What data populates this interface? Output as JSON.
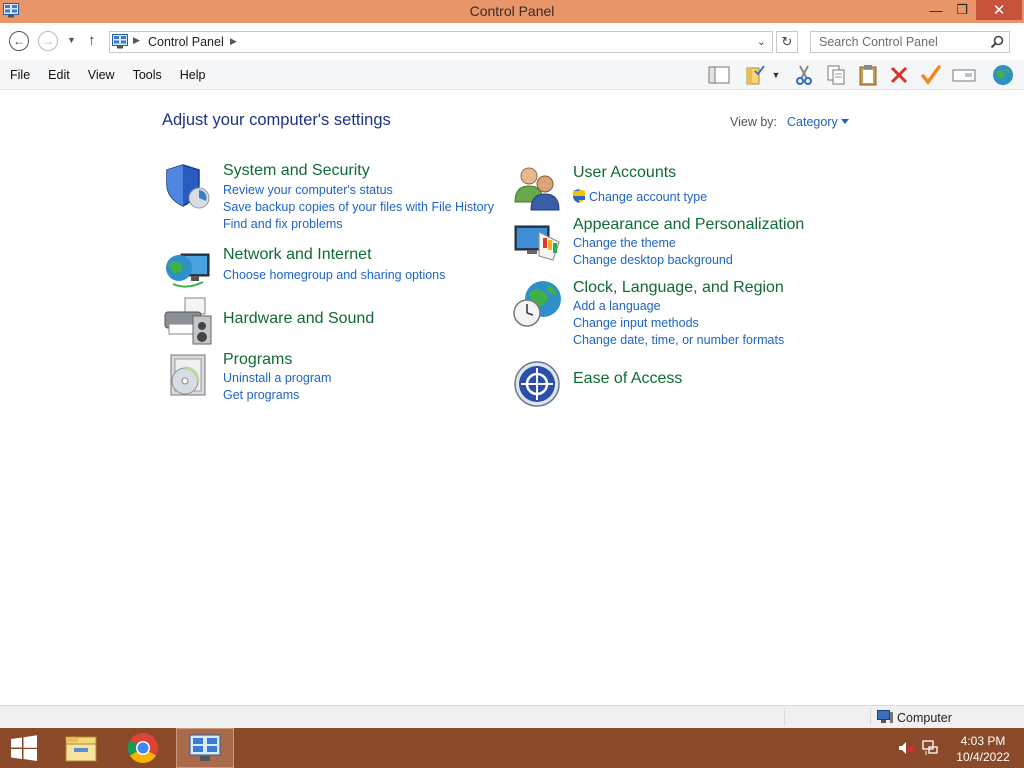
{
  "window": {
    "title": "Control Panel",
    "minimize_symbol": "—",
    "restore_symbol": "❐",
    "close_symbol": "✕"
  },
  "address": {
    "crumb": "Control Panel",
    "search_placeholder": "Search Control Panel"
  },
  "menu": {
    "items": [
      "File",
      "Edit",
      "View",
      "Tools",
      "Help"
    ]
  },
  "content": {
    "heading": "Adjust your computer's settings",
    "view_by_label": "View by:",
    "view_by_value": "Category",
    "left_categories": [
      {
        "title": "System and Security",
        "icon": "shield-icon",
        "links": [
          "Review your computer's status",
          "Save backup copies of your files with File History",
          "Find and fix problems"
        ]
      },
      {
        "title": "Network and Internet",
        "icon": "network-globe-icon",
        "links": [
          "Choose homegroup and sharing options"
        ]
      },
      {
        "title": "Hardware and Sound",
        "icon": "printer-speaker-icon",
        "links": []
      },
      {
        "title": "Programs",
        "icon": "programs-disc-icon",
        "links": [
          "Uninstall a program",
          "Get programs"
        ]
      }
    ],
    "right_categories": [
      {
        "title": "User Accounts",
        "icon": "users-icon",
        "links": [
          "Change account type"
        ]
      },
      {
        "title": "Appearance and Personalization",
        "icon": "monitor-palette-icon",
        "links": [
          "Change the theme",
          "Change desktop background"
        ]
      },
      {
        "title": "Clock, Language, and Region",
        "icon": "clock-globe-icon",
        "links": [
          "Add a language",
          "Change input methods",
          "Change date, time, or number formats"
        ]
      },
      {
        "title": "Ease of Access",
        "icon": "ease-of-access-icon",
        "links": []
      }
    ]
  },
  "status": {
    "computer_label": "Computer"
  },
  "taskbar": {
    "time": "4:03 PM",
    "date": "10/4/2022"
  },
  "colors": {
    "titlebar": "#e9956a",
    "close": "#c6523c",
    "heading": "#1e3287",
    "category_title": "#0f6b32",
    "link": "#1e64c8",
    "taskbar": "#8a4a2a"
  }
}
